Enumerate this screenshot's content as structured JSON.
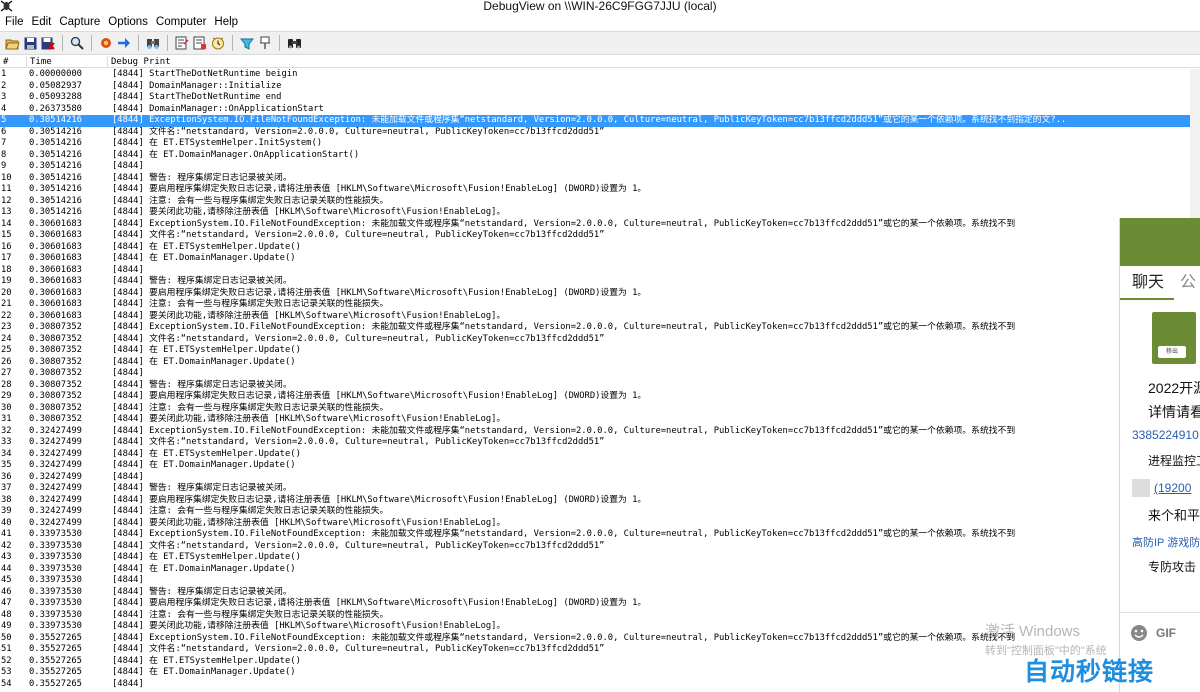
{
  "window": {
    "title": "DebugView on \\\\WIN-26C9FGG7JJU (local)"
  },
  "menu": [
    "File",
    "Edit",
    "Capture",
    "Options",
    "Computer",
    "Help"
  ],
  "toolbar": {
    "icons": [
      "open-icon",
      "save-icon",
      "clear-icon",
      "find-icon",
      "capture-icon",
      "autoscroll-icon",
      "filter-icon",
      "history-icon",
      "copy-icon",
      "clock-icon",
      "highlight-icon",
      "pin-icon",
      "binoculars-icon"
    ]
  },
  "columns": {
    "num": "#",
    "time": "Time",
    "debug": "Debug Print"
  },
  "selected_row": 4,
  "rows": [
    {
      "n": "1",
      "t": "0.00000000",
      "m": "[4844] StartTheDotNetRuntime beigin"
    },
    {
      "n": "2",
      "t": "0.05082937",
      "m": "[4844] DomainManager::Initialize"
    },
    {
      "n": "3",
      "t": "0.05093288",
      "m": "[4844] StartTheDotNetRuntime end"
    },
    {
      "n": "4",
      "t": "0.26373580",
      "m": "[4844] DomainManager::OnApplicationStart"
    },
    {
      "n": "5",
      "t": "0.30514216",
      "m": "[4844] ExceptionSystem.IO.FileNotFoundException: 未能加载文件或程序集“netstandard, Version=2.0.0.0, Culture=neutral, PublicKeyToken=cc7b13ffcd2ddd51”或它的某一个依赖项。系统找不到指定的文?.."
    },
    {
      "n": "6",
      "t": "0.30514216",
      "m": "[4844] 文件名:“netstandard, Version=2.0.0.0, Culture=neutral, PublicKeyToken=cc7b13ffcd2ddd51”"
    },
    {
      "n": "7",
      "t": "0.30514216",
      "m": "[4844]    在 ET.ETSystemHelper.InitSystem()"
    },
    {
      "n": "8",
      "t": "0.30514216",
      "m": "[4844]    在 ET.DomainManager.OnApplicationStart()"
    },
    {
      "n": "9",
      "t": "0.30514216",
      "m": "[4844]"
    },
    {
      "n": "10",
      "t": "0.30514216",
      "m": "[4844] 警告: 程序集绑定日志记录被关闭。"
    },
    {
      "n": "11",
      "t": "0.30514216",
      "m": "[4844] 要启用程序集绑定失败日志记录,请将注册表值 [HKLM\\Software\\Microsoft\\Fusion!EnableLog] (DWORD)设置为 1。"
    },
    {
      "n": "12",
      "t": "0.30514216",
      "m": "[4844] 注意: 会有一些与程序集绑定失败日志记录关联的性能损失。"
    },
    {
      "n": "13",
      "t": "0.30514216",
      "m": "[4844] 要关闭此功能,请移除注册表值 [HKLM\\Software\\Microsoft\\Fusion!EnableLog]。"
    },
    {
      "n": "14",
      "t": "0.30601683",
      "m": "[4844] ExceptionSystem.IO.FileNotFoundException: 未能加载文件或程序集“netstandard, Version=2.0.0.0, Culture=neutral, PublicKeyToken=cc7b13ffcd2ddd51”或它的某一个依赖项。系统找不到"
    },
    {
      "n": "15",
      "t": "0.30601683",
      "m": "[4844] 文件名:“netstandard, Version=2.0.0.0, Culture=neutral, PublicKeyToken=cc7b13ffcd2ddd51”"
    },
    {
      "n": "16",
      "t": "0.30601683",
      "m": "[4844]    在 ET.ETSystemHelper.Update()"
    },
    {
      "n": "17",
      "t": "0.30601683",
      "m": "[4844]    在 ET.DomainManager.Update()"
    },
    {
      "n": "18",
      "t": "0.30601683",
      "m": "[4844]"
    },
    {
      "n": "19",
      "t": "0.30601683",
      "m": "[4844] 警告: 程序集绑定日志记录被关闭。"
    },
    {
      "n": "20",
      "t": "0.30601683",
      "m": "[4844] 要启用程序集绑定失败日志记录,请将注册表值 [HKLM\\Software\\Microsoft\\Fusion!EnableLog] (DWORD)设置为 1。"
    },
    {
      "n": "21",
      "t": "0.30601683",
      "m": "[4844] 注意: 会有一些与程序集绑定失败日志记录关联的性能损失。"
    },
    {
      "n": "22",
      "t": "0.30601683",
      "m": "[4844] 要关闭此功能,请移除注册表值 [HKLM\\Software\\Microsoft\\Fusion!EnableLog]。"
    },
    {
      "n": "23",
      "t": "0.30807352",
      "m": "[4844] ExceptionSystem.IO.FileNotFoundException: 未能加载文件或程序集“netstandard, Version=2.0.0.0, Culture=neutral, PublicKeyToken=cc7b13ffcd2ddd51”或它的某一个依赖项。系统找不到"
    },
    {
      "n": "24",
      "t": "0.30807352",
      "m": "[4844] 文件名:“netstandard, Version=2.0.0.0, Culture=neutral, PublicKeyToken=cc7b13ffcd2ddd51”"
    },
    {
      "n": "25",
      "t": "0.30807352",
      "m": "[4844]    在 ET.ETSystemHelper.Update()"
    },
    {
      "n": "26",
      "t": "0.30807352",
      "m": "[4844]    在 ET.DomainManager.Update()"
    },
    {
      "n": "27",
      "t": "0.30807352",
      "m": "[4844]"
    },
    {
      "n": "28",
      "t": "0.30807352",
      "m": "[4844] 警告: 程序集绑定日志记录被关闭。"
    },
    {
      "n": "29",
      "t": "0.30807352",
      "m": "[4844] 要启用程序集绑定失败日志记录,请将注册表值 [HKLM\\Software\\Microsoft\\Fusion!EnableLog] (DWORD)设置为 1。"
    },
    {
      "n": "30",
      "t": "0.30807352",
      "m": "[4844] 注意: 会有一些与程序集绑定失败日志记录关联的性能损失。"
    },
    {
      "n": "31",
      "t": "0.30807352",
      "m": "[4844] 要关闭此功能,请移除注册表值 [HKLM\\Software\\Microsoft\\Fusion!EnableLog]。"
    },
    {
      "n": "32",
      "t": "0.32427499",
      "m": "[4844] ExceptionSystem.IO.FileNotFoundException: 未能加载文件或程序集“netstandard, Version=2.0.0.0, Culture=neutral, PublicKeyToken=cc7b13ffcd2ddd51”或它的某一个依赖项。系统找不到"
    },
    {
      "n": "33",
      "t": "0.32427499",
      "m": "[4844] 文件名:“netstandard, Version=2.0.0.0, Culture=neutral, PublicKeyToken=cc7b13ffcd2ddd51”"
    },
    {
      "n": "34",
      "t": "0.32427499",
      "m": "[4844]    在 ET.ETSystemHelper.Update()"
    },
    {
      "n": "35",
      "t": "0.32427499",
      "m": "[4844]    在 ET.DomainManager.Update()"
    },
    {
      "n": "36",
      "t": "0.32427499",
      "m": "[4844]"
    },
    {
      "n": "37",
      "t": "0.32427499",
      "m": "[4844] 警告: 程序集绑定日志记录被关闭。"
    },
    {
      "n": "38",
      "t": "0.32427499",
      "m": "[4844] 要启用程序集绑定失败日志记录,请将注册表值 [HKLM\\Software\\Microsoft\\Fusion!EnableLog] (DWORD)设置为 1。"
    },
    {
      "n": "39",
      "t": "0.32427499",
      "m": "[4844] 注意: 会有一些与程序集绑定失败日志记录关联的性能损失。"
    },
    {
      "n": "40",
      "t": "0.32427499",
      "m": "[4844] 要关闭此功能,请移除注册表值 [HKLM\\Software\\Microsoft\\Fusion!EnableLog]。"
    },
    {
      "n": "41",
      "t": "0.33973530",
      "m": "[4844] ExceptionSystem.IO.FileNotFoundException: 未能加载文件或程序集“netstandard, Version=2.0.0.0, Culture=neutral, PublicKeyToken=cc7b13ffcd2ddd51”或它的某一个依赖项。系统找不到"
    },
    {
      "n": "42",
      "t": "0.33973530",
      "m": "[4844] 文件名:“netstandard, Version=2.0.0.0, Culture=neutral, PublicKeyToken=cc7b13ffcd2ddd51”"
    },
    {
      "n": "43",
      "t": "0.33973530",
      "m": "[4844]    在 ET.ETSystemHelper.Update()"
    },
    {
      "n": "44",
      "t": "0.33973530",
      "m": "[4844]    在 ET.DomainManager.Update()"
    },
    {
      "n": "45",
      "t": "0.33973530",
      "m": "[4844]"
    },
    {
      "n": "46",
      "t": "0.33973530",
      "m": "[4844] 警告: 程序集绑定日志记录被关闭。"
    },
    {
      "n": "47",
      "t": "0.33973530",
      "m": "[4844] 要启用程序集绑定失败日志记录,请将注册表值 [HKLM\\Software\\Microsoft\\Fusion!EnableLog] (DWORD)设置为 1。"
    },
    {
      "n": "48",
      "t": "0.33973530",
      "m": "[4844] 注意: 会有一些与程序集绑定失败日志记录关联的性能损失。"
    },
    {
      "n": "49",
      "t": "0.33973530",
      "m": "[4844] 要关闭此功能,请移除注册表值 [HKLM\\Software\\Microsoft\\Fusion!EnableLog]。"
    },
    {
      "n": "50",
      "t": "0.35527265",
      "m": "[4844] ExceptionSystem.IO.FileNotFoundException: 未能加载文件或程序集“netstandard, Version=2.0.0.0, Culture=neutral, PublicKeyToken=cc7b13ffcd2ddd51”或它的某一个依赖项。系统找不到"
    },
    {
      "n": "51",
      "t": "0.35527265",
      "m": "[4844] 文件名:“netstandard, Version=2.0.0.0, Culture=neutral, PublicKeyToken=cc7b13ffcd2ddd51”"
    },
    {
      "n": "52",
      "t": "0.35527265",
      "m": "[4844]    在 ET.ETSystemHelper.Update()"
    },
    {
      "n": "53",
      "t": "0.35527265",
      "m": "[4844]    在 ET.DomainManager.Update()"
    },
    {
      "n": "54",
      "t": "0.35527265",
      "m": "[4844]"
    }
  ],
  "side_panel": {
    "tab_chat": "聊天",
    "tab_other": "公",
    "card_button": "移出",
    "line1": "2022开源",
    "line2": "详情请看",
    "link1": "3385224910",
    "line3": "进程监控工",
    "link2": "(19200",
    "line4": "来个和平",
    "link3": "高防IP 游戏防",
    "line5": "专防攻击",
    "gif_label": "GIF"
  },
  "overlay": {
    "activate_title": "激活 Windows",
    "activate_hint": "转到\"控制面板\"中的\"系统",
    "brand": "自动秒链接"
  },
  "colors": {
    "selection": "#3399ff",
    "side_green": "#6b8b35",
    "brand_blue": "#1e8fe0"
  }
}
